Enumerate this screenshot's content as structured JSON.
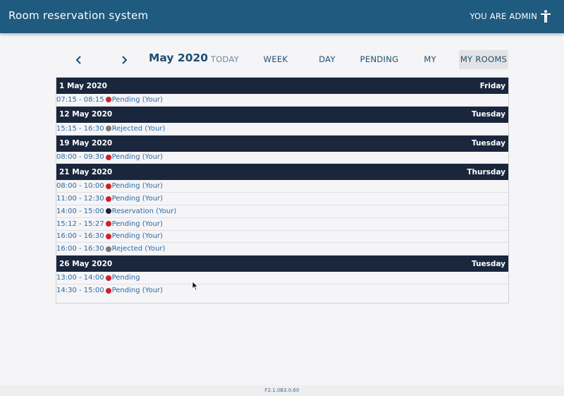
{
  "app": {
    "title": "Room reservation system",
    "user_label": "YOU ARE ADMIN",
    "user_icon": "accessibility-icon"
  },
  "toolbar": {
    "month": "May 2020",
    "buttons": [
      {
        "label": "TODAY",
        "state": "disabled"
      },
      {
        "label": "WEEK",
        "state": "normal"
      },
      {
        "label": "DAY",
        "state": "normal"
      },
      {
        "label": "PENDING",
        "state": "normal"
      },
      {
        "label": "MY",
        "state": "normal"
      },
      {
        "label": "MY ROOMS",
        "state": "active"
      }
    ]
  },
  "status_colors": {
    "pending": "#d0202c",
    "rejected": "#7a7a7a",
    "reservation": "#19263c"
  },
  "days": [
    {
      "date": "1 May 2020",
      "weekday": "Friday",
      "events": [
        {
          "time": "07:15 - 08:15",
          "status": "pending",
          "label": "Pending (Your)"
        }
      ]
    },
    {
      "date": "12 May 2020",
      "weekday": "Tuesday",
      "events": [
        {
          "time": "15:15 - 16:30",
          "status": "rejected",
          "label": "Rejected (Your)"
        }
      ]
    },
    {
      "date": "19 May 2020",
      "weekday": "Tuesday",
      "events": [
        {
          "time": "08:00 - 09:30",
          "status": "pending",
          "label": "Pending (Your)"
        }
      ]
    },
    {
      "date": "21 May 2020",
      "weekday": "Thursday",
      "events": [
        {
          "time": "08:00 - 10:00",
          "status": "pending",
          "label": "Pending (Your)"
        },
        {
          "time": "11:00 - 12:30",
          "status": "pending",
          "label": "Pending (Your)"
        },
        {
          "time": "14:00 - 15:00",
          "status": "reservation",
          "label": "Reservation (Your)"
        },
        {
          "time": "15:12 - 15:27",
          "status": "pending",
          "label": "Pending (Your)"
        },
        {
          "time": "16:00 - 16:30",
          "status": "pending",
          "label": "Pending (Your)"
        },
        {
          "time": "16:00 - 16:30",
          "status": "rejected",
          "label": "Rejected (Your)"
        }
      ]
    },
    {
      "date": "26 May 2020",
      "weekday": "Tuesday",
      "events": [
        {
          "time": "13:00 - 14:00",
          "status": "pending",
          "label": "Pending"
        },
        {
          "time": "14:30 - 15:00",
          "status": "pending",
          "label": "Pending (Your)"
        }
      ]
    }
  ],
  "footer": {
    "version": "F2.1.0B3.0.60"
  }
}
